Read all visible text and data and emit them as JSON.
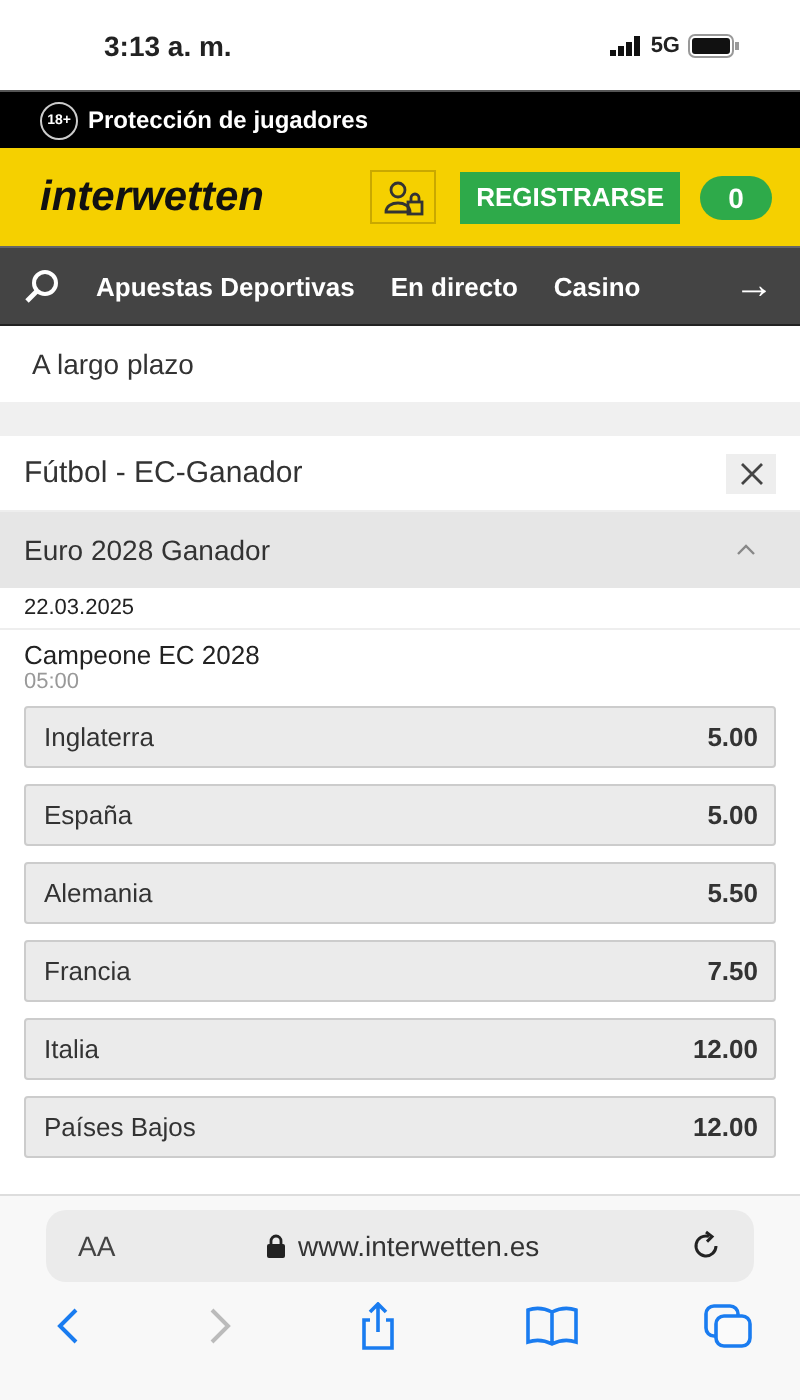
{
  "status_bar": {
    "time": "3:13 a. m.",
    "network": "5G"
  },
  "top_bar": {
    "age_badge": "18+",
    "label": "Protección de jugadores"
  },
  "header": {
    "logo": "interwetten",
    "register": "REGISTRARSE",
    "balance": "0"
  },
  "nav": {
    "items": [
      "Apuestas Deportivas",
      "En directo",
      "Casino"
    ],
    "more": "→"
  },
  "breadcrumb": "A largo plazo",
  "market": {
    "title": "Fútbol - EC-Ganador",
    "group": "Euro 2028 Ganador",
    "expanded": true,
    "date": "22.03.2025",
    "event": "Campeone EC 2028",
    "time": "05:00",
    "odds": [
      {
        "name": "Inglaterra",
        "price": "5.00"
      },
      {
        "name": "España",
        "price": "5.00"
      },
      {
        "name": "Alemania",
        "price": "5.50"
      },
      {
        "name": "Francia",
        "price": "7.50"
      },
      {
        "name": "Italia",
        "price": "12.00"
      },
      {
        "name": "Países Bajos",
        "price": "12.00"
      }
    ]
  },
  "browser": {
    "text_size": "AA",
    "url": "www.interwetten.es"
  }
}
